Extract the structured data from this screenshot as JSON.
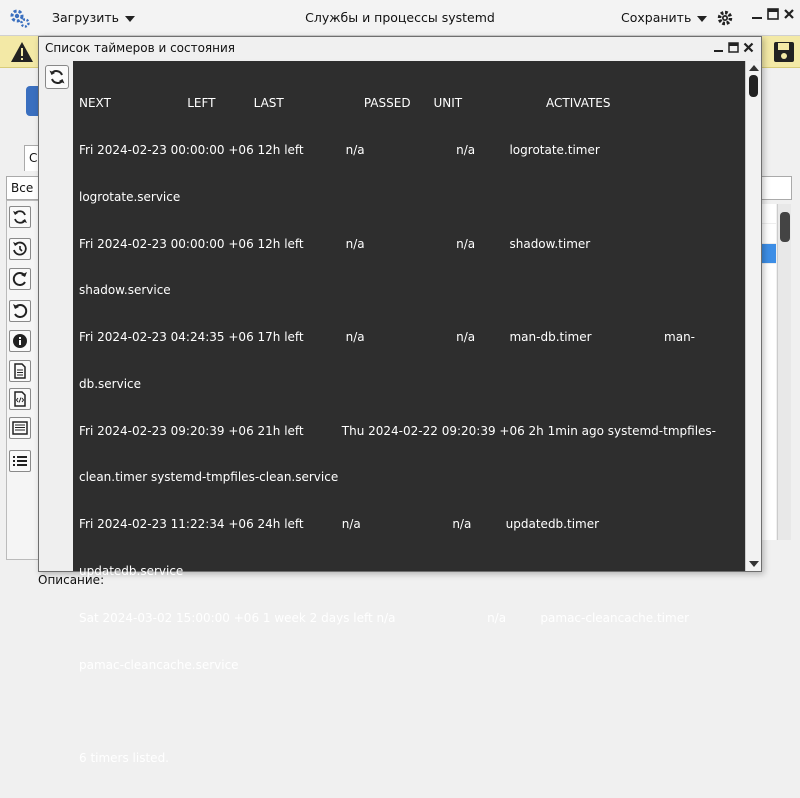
{
  "app": {
    "menu_load": "Загрузить",
    "title": "Службы и процессы systemd",
    "menu_save": "Сохранить"
  },
  "background": {
    "tab_label": "С",
    "filter_value": "Все",
    "description_label": "Описание:"
  },
  "dialog": {
    "title": "Список таймеров и состояния",
    "output_lines": [
      "NEXT                    LEFT          LAST                     PASSED      UNIT                      ACTIVATES",
      "Fri 2024-02-23 00:00:00 +06 12h left           n/a                        n/a         logrotate.timer",
      "logrotate.service",
      "Fri 2024-02-23 00:00:00 +06 12h left           n/a                        n/a         shadow.timer",
      "shadow.service",
      "Fri 2024-02-23 04:24:35 +06 17h left           n/a                        n/a         man-db.timer                   man-",
      "db.service",
      "Fri 2024-02-23 09:20:39 +06 21h left          Thu 2024-02-22 09:20:39 +06 2h 1min ago systemd-tmpfiles-",
      "clean.timer systemd-tmpfiles-clean.service",
      "Fri 2024-02-23 11:22:34 +06 24h left          n/a                        n/a         updatedb.timer",
      "updatedb.service",
      "Sat 2024-03-02 15:00:00 +06 1 week 2 days left n/a                        n/a         pamac-cleancache.timer",
      "pamac-cleancache.service",
      "",
      "6 timers listed."
    ]
  },
  "colors": {
    "terminal_bg": "#2e2e2e",
    "warning_bar": "#f3e9a6",
    "selection": "#3d8ee6"
  }
}
